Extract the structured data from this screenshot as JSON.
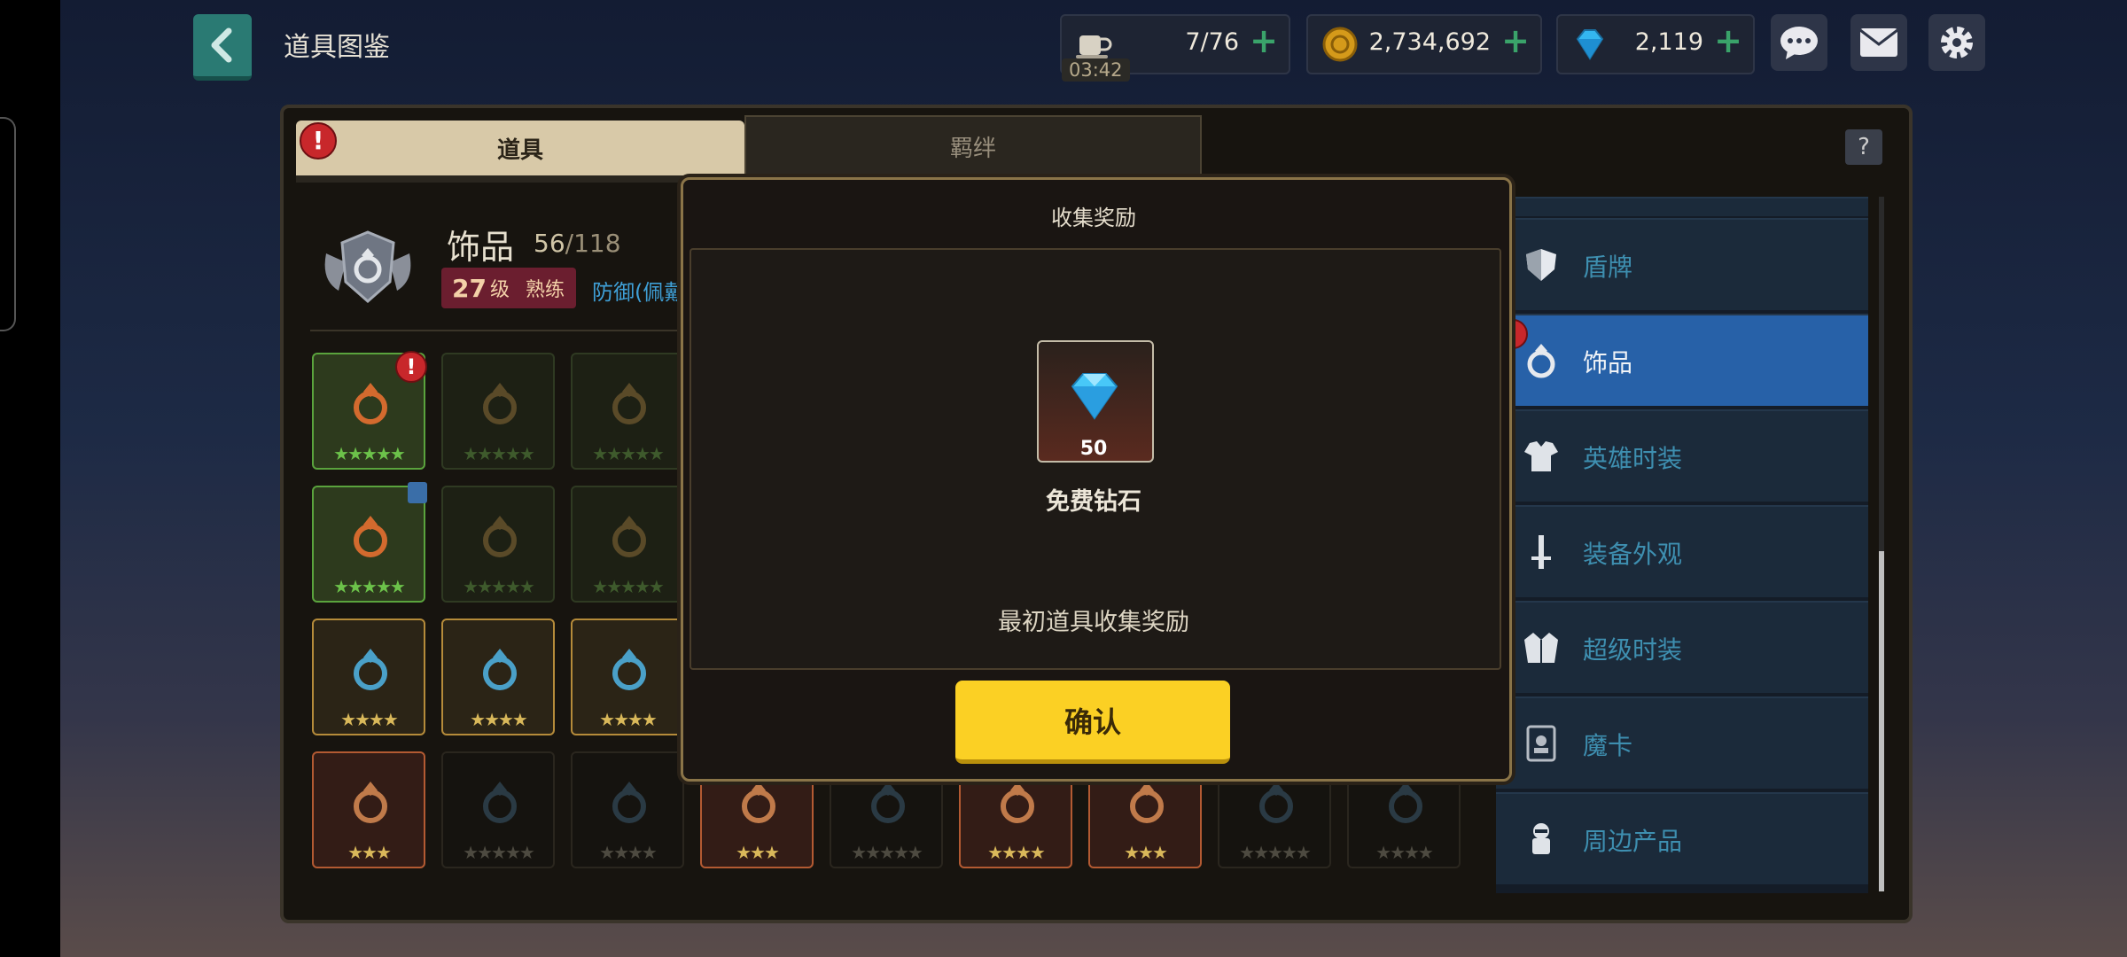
{
  "header": {
    "title": "道具图鉴",
    "stamina": {
      "value": "7/76",
      "timer": "03:42"
    },
    "gold": {
      "value": "2,734,692"
    },
    "gems": {
      "value": "2,119"
    },
    "icons": [
      "chat-icon",
      "mail-icon",
      "gear-icon"
    ]
  },
  "tabs": [
    {
      "label": "道具",
      "selected": true
    },
    {
      "label": "羁绊",
      "selected": false
    }
  ],
  "help_label": "?",
  "category_info": {
    "name": "饰品",
    "collected": "56",
    "total": "/118",
    "level": "27",
    "level_unit": "级",
    "rank": "熟练",
    "stat": "防御(佩戴"
  },
  "item_grid": {
    "rows": [
      [
        {
          "stars": "★★★★★",
          "frame": "green"
        },
        {
          "stars": "★★★★★",
          "frame": "green-dim"
        },
        {
          "stars": "★★★★★",
          "frame": "green-dim"
        }
      ],
      [
        {
          "stars": "★★★★★",
          "frame": "green"
        },
        {
          "stars": "★★★★★",
          "frame": "green-dim"
        },
        {
          "stars": "★★★★★",
          "frame": "green-dim"
        }
      ],
      [
        {
          "stars": "★★★★",
          "frame": "gold"
        },
        {
          "stars": "★★★★",
          "frame": "gold"
        },
        {
          "stars": "★★★★",
          "frame": "gold"
        }
      ],
      [
        {
          "stars": "★★★",
          "frame": "red"
        },
        {
          "stars": "★★★★★",
          "frame": "dark"
        },
        {
          "stars": "★★★★",
          "frame": "dark"
        },
        {
          "stars": "★★★",
          "frame": "red"
        },
        {
          "stars": "★★★★★",
          "frame": "dark"
        },
        {
          "stars": "★★★★",
          "frame": "red"
        },
        {
          "stars": "★★★",
          "frame": "red"
        },
        {
          "stars": "★★★★★",
          "frame": "dark"
        },
        {
          "stars": "★★★★",
          "frame": "dark"
        }
      ]
    ]
  },
  "sidebar": {
    "items": [
      {
        "label": "盾牌",
        "icon": "shield-icon"
      },
      {
        "label": "饰品",
        "icon": "ring-icon",
        "selected": true
      },
      {
        "label": "英雄时装",
        "icon": "armor-icon"
      },
      {
        "label": "装备外观",
        "icon": "sword-icon"
      },
      {
        "label": "超级时装",
        "icon": "jacket-icon"
      },
      {
        "label": "魔卡",
        "icon": "card-icon"
      },
      {
        "label": "周边产品",
        "icon": "figure-icon"
      }
    ]
  },
  "modal": {
    "title": "收集奖励",
    "reward_qty": "50",
    "reward_name": "免费钻石",
    "description": "最初道具收集奖励",
    "confirm_label": "确认"
  },
  "colors": {
    "accent_yellow": "#fbd024",
    "selected_blue": "#2761a8",
    "alert_red": "#c8272b",
    "gem_blue": "#34b6f0"
  }
}
